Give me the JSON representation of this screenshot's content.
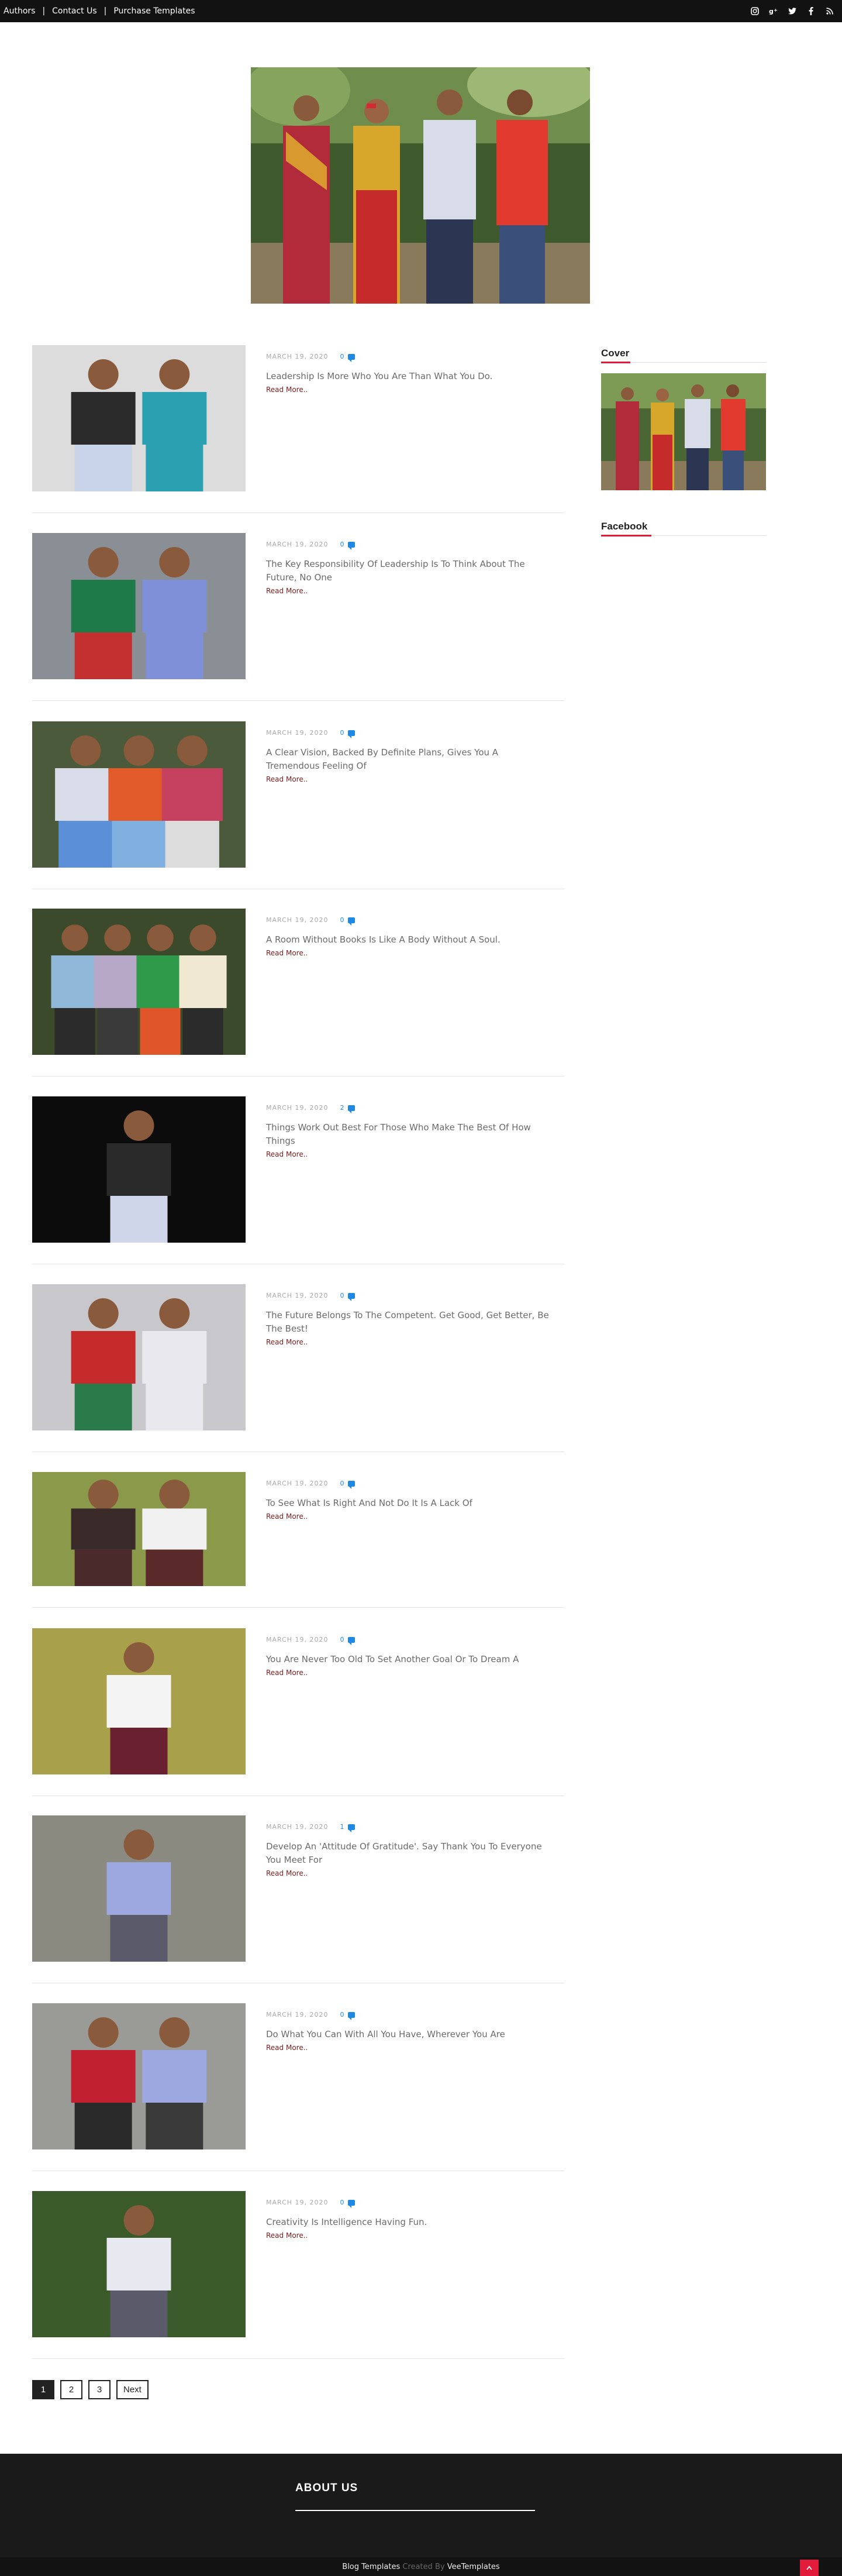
{
  "topnav": {
    "items": [
      "Authors",
      "Contact Us",
      "Purchase Templates"
    ],
    "separator": "|"
  },
  "socials": [
    "instagram-icon",
    "google-plus-icon",
    "twitter-icon",
    "facebook-icon",
    "rss-icon"
  ],
  "posts": [
    {
      "date": "MARCH 19, 2020",
      "comments": "0",
      "title": "Leadership Is More Who You Are Than What You Do.",
      "read_more": "Read More.."
    },
    {
      "date": "MARCH 19, 2020",
      "comments": "0",
      "title": "The Key Responsibility Of Leadership Is To Think About The Future, No One",
      "read_more": "Read More.."
    },
    {
      "date": "MARCH 19, 2020",
      "comments": "0",
      "title": "A Clear Vision, Backed By Definite Plans, Gives You A Tremendous Feeling Of",
      "read_more": "Read More.."
    },
    {
      "date": "MARCH 19, 2020",
      "comments": "0",
      "title": "A Room Without Books Is Like A Body Without A Soul.",
      "read_more": "Read More.."
    },
    {
      "date": "MARCH 19, 2020",
      "comments": "2",
      "title": "Things Work Out Best For Those Who Make The Best Of How Things",
      "read_more": "Read More.."
    },
    {
      "date": "MARCH 19, 2020",
      "comments": "0",
      "title": "The Future Belongs To The Competent. Get Good, Get Better, Be The Best!",
      "read_more": "Read More.."
    },
    {
      "date": "MARCH 19, 2020",
      "comments": "0",
      "title": "To See What Is Right And Not Do It Is A Lack Of",
      "read_more": "Read More.."
    },
    {
      "date": "MARCH 19, 2020",
      "comments": "0",
      "title": "You Are Never Too Old To Set Another Goal Or To Dream A",
      "read_more": "Read More.."
    },
    {
      "date": "MARCH 19, 2020",
      "comments": "1",
      "title": "Develop An 'Attitude Of Gratitude'. Say Thank You To Everyone You Meet For",
      "read_more": "Read More.."
    },
    {
      "date": "MARCH 19, 2020",
      "comments": "0",
      "title": "Do What You Can With All You Have, Wherever You Are",
      "read_more": "Read More.."
    },
    {
      "date": "MARCH 19, 2020",
      "comments": "0",
      "title": "Creativity Is Intelligence Having Fun.",
      "read_more": "Read More.."
    }
  ],
  "sidebar": {
    "cover_title": "Cover",
    "facebook_title": "Facebook"
  },
  "pagination": {
    "pages": [
      "1",
      "2",
      "3"
    ],
    "next": "Next",
    "active": "1"
  },
  "footer": {
    "about_title": "ABOUT US",
    "credit_prefix": "Blog Templates",
    "credit_mid": "Created By",
    "credit_suffix": "VeeTemplates"
  },
  "colors": {
    "topbar": "#121212",
    "accent": "#e31b3b",
    "comment": "#1e88e5",
    "read_more": "#7a1a1a"
  }
}
